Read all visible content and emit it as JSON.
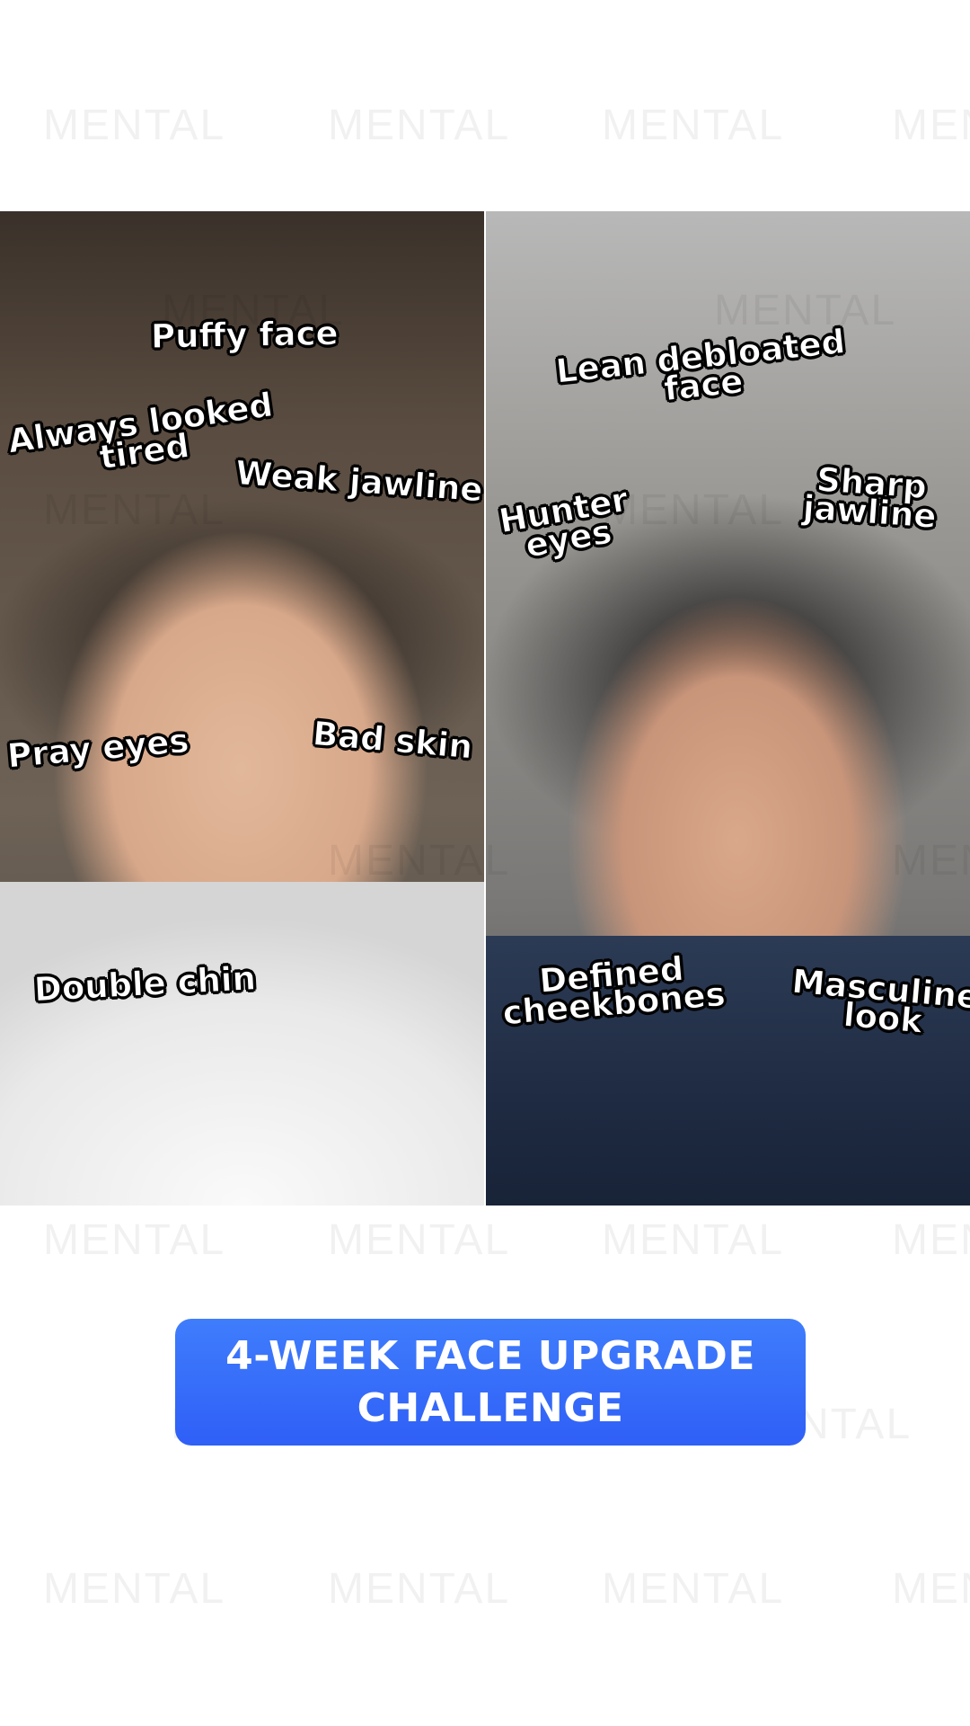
{
  "watermark": "MENTAL",
  "before": {
    "labels": [
      "Puffy face",
      "Always looked\ntired",
      "Weak  jawline",
      "Pray eyes",
      "Bad skin",
      "Double chin"
    ]
  },
  "after": {
    "labels": [
      "Lean debloated\nface",
      "Hunter\neyes",
      "Sharp\njawline",
      "Defined\ncheekbones",
      "Masculine\nlook"
    ]
  },
  "cta": {
    "label": "4-WEEK FACE UPGRADE\nCHALLENGE",
    "color": "#3366ff"
  }
}
